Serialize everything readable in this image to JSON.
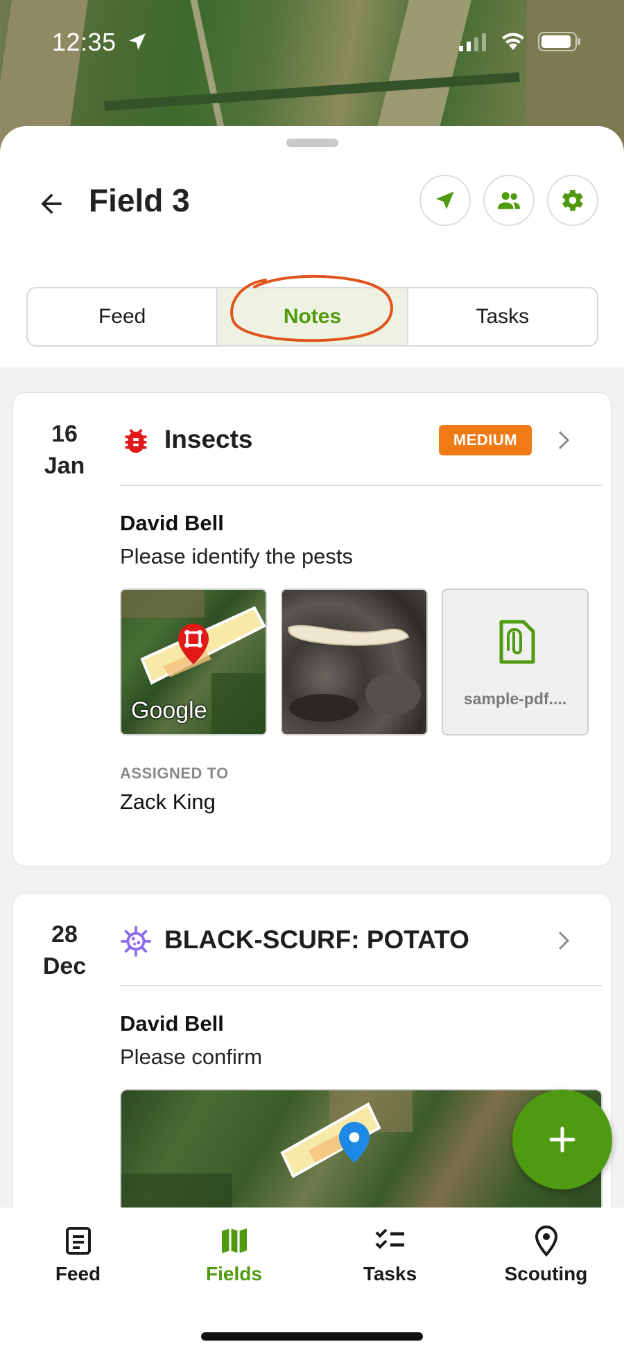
{
  "status_bar": {
    "time": "12:35",
    "icons": [
      "location-arrow-icon",
      "signal-icon",
      "wifi-icon",
      "battery-icon"
    ]
  },
  "header": {
    "title": "Field 3",
    "back_icon": "arrow-left-icon",
    "actions": [
      "navigate-icon",
      "people-icon",
      "gear-icon"
    ]
  },
  "tabs": [
    {
      "label": "Feed",
      "active": false
    },
    {
      "label": "Notes",
      "active": true
    },
    {
      "label": "Tasks",
      "active": false
    }
  ],
  "notes": [
    {
      "day": "16",
      "month": "Jan",
      "category": "Insects",
      "category_icon": "bug-icon",
      "severity": "MEDIUM",
      "author": "David Bell",
      "message": "Please identify the pests",
      "attachments": {
        "map_label": "Google",
        "file_name": "sample-pdf...."
      },
      "assigned_label": "ASSIGNED TO",
      "assigned_to": "Zack King"
    },
    {
      "day": "28",
      "month": "Dec",
      "category": "BLACK-SCURF: POTATO",
      "category_icon": "virus-icon",
      "author": "David Bell",
      "message": "Please confirm"
    }
  ],
  "fab": {
    "icon": "plus-icon"
  },
  "bottom_nav": [
    {
      "label": "Feed",
      "icon": "document-icon",
      "active": false
    },
    {
      "label": "Fields",
      "icon": "map-icon",
      "active": true
    },
    {
      "label": "Tasks",
      "icon": "checklist-icon",
      "active": false
    },
    {
      "label": "Scouting",
      "icon": "pin-icon",
      "active": false
    }
  ],
  "colors": {
    "accent": "#4f9a0e",
    "badge": "#f07a14",
    "annotation": "#e0531c"
  }
}
